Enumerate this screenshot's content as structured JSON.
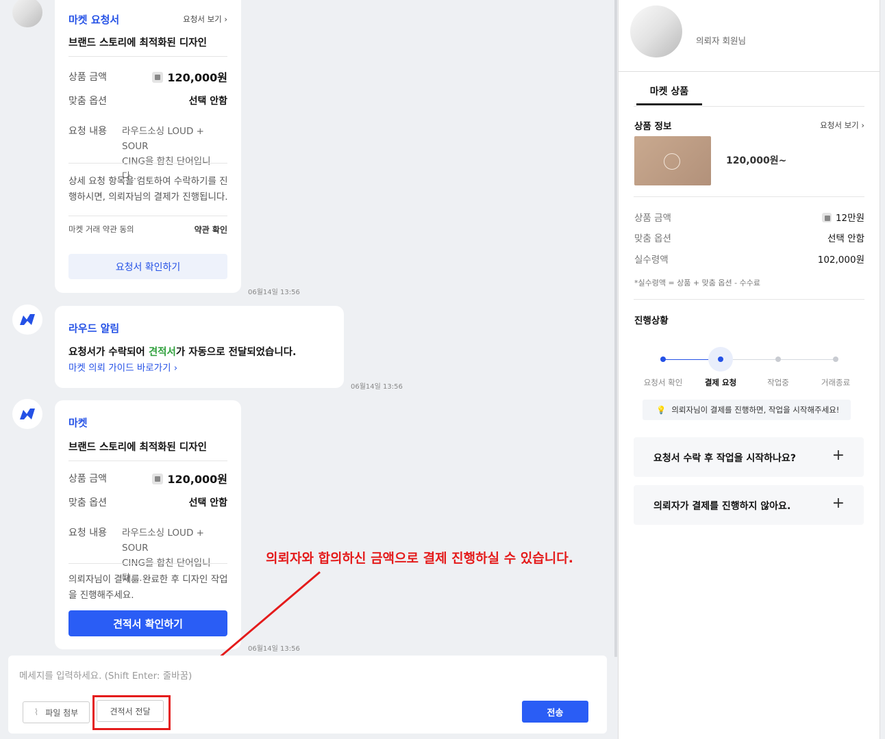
{
  "chat": {
    "request_card": {
      "title": "마켓 요청서",
      "view_link": "요청서 보기",
      "subtitle": "브랜드 스토리에 최적화된 디자인",
      "price_label": "상품 금액",
      "price_value": "120,000원",
      "option_label": "맞춤 옵션",
      "option_value": "선택 안함",
      "content_label": "요청 내용",
      "content_line1": "라우드소싱 LOUD + SOUR",
      "content_line2": "CING을 합친 단어입니다....",
      "notice_line1": "상세 요청 항목을 검토하여 수락하기를 진",
      "notice_line2": "행하시면, 의뢰자님의 결제가 진행됩니다.",
      "terms_label": "마켓 거래 약관 동의",
      "terms_link": "약관 확인",
      "button": "요청서 확인하기",
      "time": "06월14일 13:56"
    },
    "alert_card": {
      "title": "라우드 알림",
      "msg_part1": "요청서가 수락되어 ",
      "msg_highlight": "견적서",
      "msg_part2": "가 자동으로 전달되었습니다.",
      "guide_link": "마켓 의뢰 가이드 바로가기",
      "time": "06월14일 13:56"
    },
    "market_card": {
      "title": "마켓",
      "subtitle": "브랜드 스토리에 최적화된 디자인",
      "price_label": "상품 금액",
      "price_value": "120,000원",
      "option_label": "맞춤 옵션",
      "option_value": "선택 안함",
      "content_label": "요청 내용",
      "content_line1": "라우드소싱 LOUD + SOUR",
      "content_line2": "CING을 합친 단어입니다....",
      "notice_line1": "의뢰자님이 결제를 완료한 후 디자인 작업",
      "notice_line2": "을 진행해주세요.",
      "button": "견적서 확인하기",
      "time": "06월14일 13:56"
    },
    "input": {
      "placeholder": "메세지를 입력하세요. (Shift  Enter: 줄바꿈)",
      "attach": "파일 첨부",
      "quote": "견적서 전달",
      "send": "전송"
    },
    "annotation": "의뢰자와 합의하신 금액으로 결제 진행하실 수 있습니다."
  },
  "panel": {
    "user_name": "의뢰자 회원님",
    "tab": "마켓 상품",
    "product_info": "상품 정보",
    "view_link": "요청서 보기",
    "price_from": "120,000원~",
    "rows": [
      {
        "k": "상품 금액",
        "v": "12만원"
      },
      {
        "k": "맞춤 옵션",
        "v": "선택 안함"
      },
      {
        "k": "실수령액",
        "v": "102,000원"
      }
    ],
    "footnote": "*실수령액 = 상품 + 맞춤 옵션 - 수수료",
    "progress_title": "진행상황",
    "steps": [
      "요청서 확인",
      "결제 요청",
      "작업중",
      "거래종료"
    ],
    "current_step": 2,
    "tip": "의뢰자님이 결제를 진행하면, 작업을 시작해주세요!",
    "faq": [
      "요청서 수락 후 작업을 시작하나요?",
      "의뢰자가 결제를 진행하지 않아요."
    ]
  },
  "colors": {
    "accent": "#2a5df5",
    "link": "#2451e6",
    "green": "#2e9f3b",
    "annotation": "#e41b1b"
  }
}
